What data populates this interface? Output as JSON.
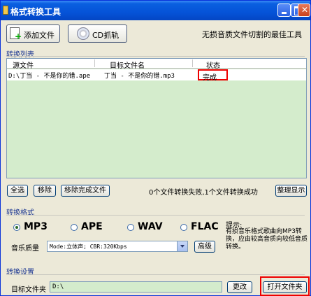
{
  "window": {
    "title": "格式转换工具"
  },
  "toolbar": {
    "add_file": "添加文件",
    "cd_rip": "CD抓轨",
    "slogan": "无损音质文件切割的最佳工具"
  },
  "convert_list": {
    "section_title": "转换列表",
    "columns": [
      "源文件",
      "目标文件名",
      "状态"
    ],
    "rows": [
      {
        "source": "D:\\丁当 - 不是你的错.ape",
        "target": "丁当 - 不是你的错.mp3",
        "status": "完成"
      }
    ]
  },
  "list_actions": {
    "select_all": "全选",
    "remove": "移除",
    "remove_completed": "移除完成文件",
    "status_message": "0个文件转换失败,1个文件转换成功",
    "hide_log": "整理显示"
  },
  "format": {
    "section_title": "转换格式",
    "options": [
      "MP3",
      "APE",
      "WAV",
      "FLAC"
    ],
    "selected": "MP3",
    "hint_title": "提示:",
    "hint_text": "有损音乐格式歌曲向MP3转换，应由较高音质向较低音质转换。",
    "quality_label": "音乐质量",
    "quality_value": "Mode:立体声; CBR:320Kbps",
    "advanced": "高级"
  },
  "settings": {
    "section_title": "转换设置",
    "target_folder_label": "目标文件夹",
    "target_folder_value": "D:\\",
    "change": "更改",
    "open_folder": "打开文件夹"
  },
  "colors": {
    "titlebar": "#0553d8",
    "list_background": "#d4eccc",
    "highlight": "#e00000"
  }
}
